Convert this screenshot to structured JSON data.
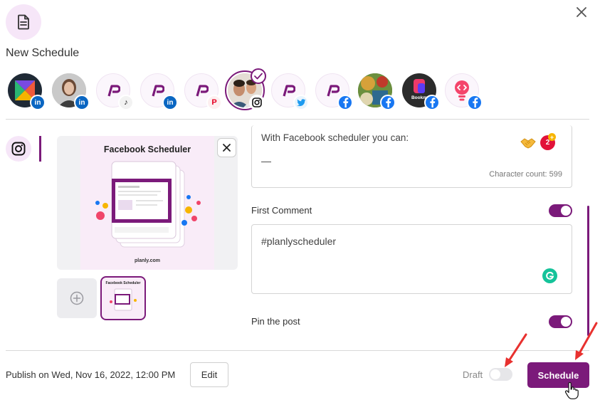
{
  "modal": {
    "title": "New Schedule",
    "icon": "document-icon",
    "close_icon": "close-icon"
  },
  "accounts": [
    {
      "name": "brand-logo-account",
      "network": "linkedin",
      "selected": false
    },
    {
      "name": "woman-profile-account",
      "network": "linkedin",
      "selected": false
    },
    {
      "name": "planly-account",
      "network": "tiktok",
      "selected": false
    },
    {
      "name": "planly-account",
      "network": "linkedin",
      "selected": false
    },
    {
      "name": "planly-account",
      "network": "pinterest",
      "selected": false
    },
    {
      "name": "two-men-profile-account",
      "network": "instagram",
      "selected": true
    },
    {
      "name": "planly-account",
      "network": "twitter",
      "selected": false
    },
    {
      "name": "planly-account",
      "network": "facebook",
      "selected": false
    },
    {
      "name": "painting-account",
      "network": "facebook",
      "selected": false
    },
    {
      "name": "bookmark-account",
      "network": "facebook",
      "selected": false
    },
    {
      "name": "bulb-code-account",
      "network": "facebook",
      "selected": false
    }
  ],
  "network_badges": {
    "linkedin": "in",
    "tiktok": "♪",
    "pinterest": "P"
  },
  "avatar_labels": {
    "bookmark": "Bookm"
  },
  "active_network_tab": "instagram",
  "media": {
    "preview_title": "Facebook Scheduler",
    "preview_footer": "planly.com",
    "add_icon": "plus-circle-icon",
    "remove_icon": "close-icon"
  },
  "caption": {
    "text": "With Facebook scheduler you can:",
    "dash": "—",
    "char_count_label": "Character count:",
    "char_count_value": "599",
    "emoji_icon": "handshake-emoji-icon",
    "counter_value": "2",
    "counter_plus": "+"
  },
  "first_comment": {
    "label": "First Comment",
    "enabled": true,
    "text": "#planlyscheduler",
    "grammarly_icon": "grammarly-icon"
  },
  "pin_post": {
    "label": "Pin the post",
    "enabled": true
  },
  "footer": {
    "publish_text": "Publish on Wed, Nov 16, 2022, 12:00 PM",
    "edit_label": "Edit",
    "draft_label": "Draft",
    "draft_enabled": false,
    "schedule_label": "Schedule"
  },
  "colors": {
    "brand_purple": "#7b1a7a",
    "light_purple": "#f6e6f8",
    "annotation_red": "#e8312f"
  }
}
